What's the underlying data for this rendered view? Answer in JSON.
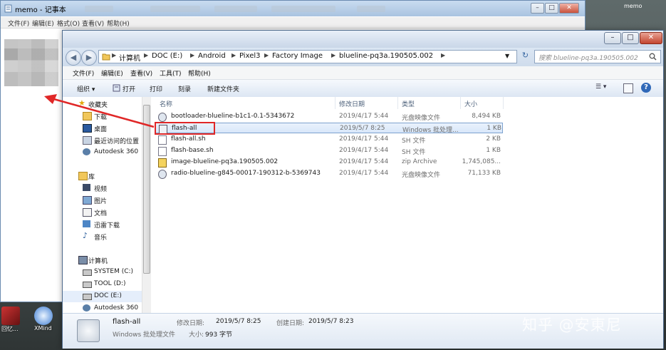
{
  "notepad": {
    "title": "memo - 记事本",
    "menu": [
      "文件(F)",
      "编辑(E)",
      "格式(O)",
      "查看(V)",
      "帮助(H)"
    ],
    "min_btn": "–",
    "max_btn": "□",
    "close_btn": "✕"
  },
  "top_right_label": "memo",
  "explorer": {
    "window_buttons": {
      "minimize": "–",
      "maximize": "□",
      "close": "✕"
    },
    "nav": {
      "back": "◀",
      "forward": "▶"
    },
    "breadcrumbs": [
      "计算机",
      "DOC (E:)",
      "Android",
      "Pixel3",
      "Factory Image",
      "blueline-pq3a.190505.002"
    ],
    "search_placeholder": "搜索 blueline-pq3a.190505.002",
    "menu": [
      "文件(F)",
      "编辑(E)",
      "查看(V)",
      "工具(T)",
      "帮助(H)"
    ],
    "toolbar": {
      "organize": "组织 ▾",
      "open": "打开",
      "print": "打印",
      "burn": "刻录",
      "new_folder": "新建文件夹"
    },
    "nav_pane": [
      {
        "label": "收藏夹",
        "icon": "star-icon",
        "kind": "group"
      },
      {
        "label": "下载",
        "icon": "download-folder-icon",
        "kind": "item"
      },
      {
        "label": "桌面",
        "icon": "desktop-icon",
        "kind": "item"
      },
      {
        "label": "最近访问的位置",
        "icon": "recent-places-icon",
        "kind": "item"
      },
      {
        "label": "Autodesk 360",
        "icon": "cloud-icon",
        "kind": "item"
      },
      {
        "label": "库",
        "icon": "library-icon",
        "kind": "group"
      },
      {
        "label": "视频",
        "icon": "video-icon",
        "kind": "item"
      },
      {
        "label": "图片",
        "icon": "picture-icon",
        "kind": "item"
      },
      {
        "label": "文档",
        "icon": "document-icon",
        "kind": "item"
      },
      {
        "label": "迅雷下载",
        "icon": "thunder-icon",
        "kind": "item"
      },
      {
        "label": "音乐",
        "icon": "music-icon",
        "kind": "item"
      },
      {
        "label": "计算机",
        "icon": "computer-icon",
        "kind": "group"
      },
      {
        "label": "SYSTEM (C:)",
        "icon": "drive-icon",
        "kind": "item"
      },
      {
        "label": "TOOL (D:)",
        "icon": "drive-icon",
        "kind": "item"
      },
      {
        "label": "DOC (E:)",
        "icon": "drive-icon",
        "kind": "item",
        "selected": true
      },
      {
        "label": "Autodesk 360",
        "icon": "cloud-icon",
        "kind": "item"
      }
    ],
    "columns": {
      "name": "名称",
      "date": "修改日期",
      "type": "类型",
      "size": "大小"
    },
    "files": [
      {
        "name": "bootloader-blueline-b1c1-0.1-5343672",
        "date": "2019/4/17 5:44",
        "type": "光盘映像文件",
        "size": "8,494 KB",
        "icon": "disc-image-icon"
      },
      {
        "name": "flash-all",
        "date": "2019/5/7 8:25",
        "type": "Windows 批处理...",
        "size": "1 KB",
        "icon": "batch-file-icon",
        "selected": true
      },
      {
        "name": "flash-all.sh",
        "date": "2019/4/17 5:44",
        "type": "SH 文件",
        "size": "2 KB",
        "icon": "file-icon"
      },
      {
        "name": "flash-base.sh",
        "date": "2019/4/17 5:44",
        "type": "SH 文件",
        "size": "1 KB",
        "icon": "file-icon"
      },
      {
        "name": "image-blueline-pq3a.190505.002",
        "date": "2019/4/17 5:44",
        "type": "zip Archive",
        "size": "1,745,085...",
        "icon": "zip-icon"
      },
      {
        "name": "radio-blueline-g845-00017-190312-b-5369743",
        "date": "2019/4/17 5:44",
        "type": "光盘映像文件",
        "size": "71,133 KB",
        "icon": "disc-image-icon"
      }
    ],
    "details": {
      "name": "flash-all",
      "type": "Windows 批处理文件",
      "modified_label": "修改日期:",
      "modified": "2019/5/7 8:25",
      "created_label": "创建日期:",
      "created": "2019/5/7 8:23",
      "size_label": "大小:",
      "size": "993 字节"
    }
  },
  "desktop_icons": [
    {
      "label": "回忆...",
      "icon": "app-icon"
    },
    {
      "label": "XMind",
      "icon": "xmind-icon"
    }
  ],
  "watermark": "知乎 @安東尼",
  "colors": {
    "highlight_border": "#e02727",
    "selection": "#d8e7fa",
    "arrow": "#e02727"
  }
}
